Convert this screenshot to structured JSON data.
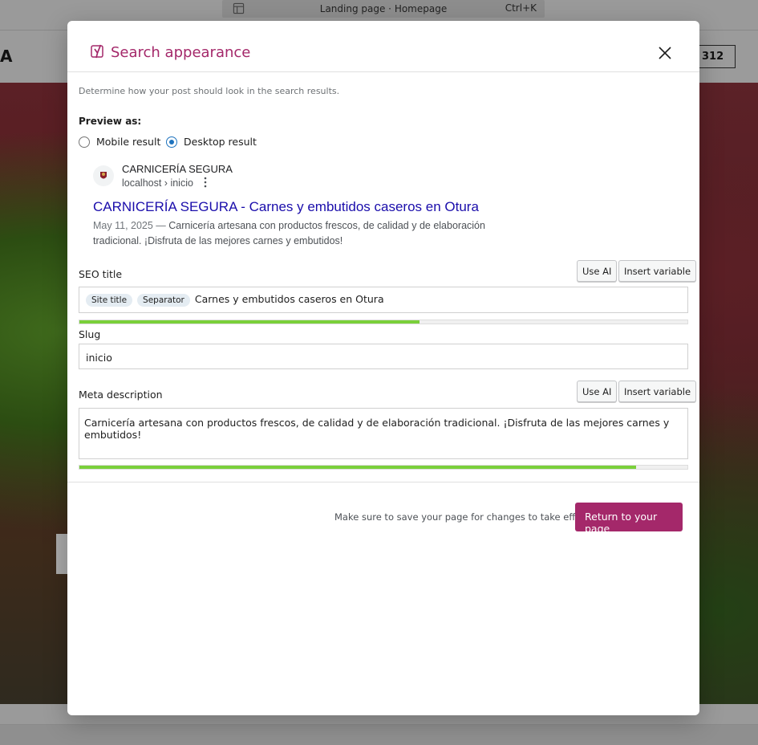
{
  "background": {
    "command_bar": {
      "label": "Landing page · Homepage",
      "shortcut": "Ctrl+K"
    },
    "logo_fragment": "A",
    "phone_button": "312"
  },
  "modal": {
    "title": "Search appearance",
    "intro": "Determine how your post should look in the search results.",
    "preview_label": "Preview as:",
    "preview_options": [
      {
        "label": "Mobile result",
        "checked": false
      },
      {
        "label": "Desktop result",
        "checked": true
      }
    ],
    "google_preview": {
      "site_name": "CARNICERÍA SEGURA",
      "url": "localhost › inicio",
      "title": "CARNICERÍA SEGURA - Carnes y embutidos caseros en Otura",
      "date": "May 11, 2025 —",
      "description": "Carnicería artesana con productos frescos, de calidad y de elaboración tradicional. ¡Disfruta de las mejores carnes y embutidos!"
    },
    "seo_title": {
      "label": "SEO title",
      "use_ai": "Use AI",
      "insert_variable": "Insert variable",
      "pills": [
        "Site title",
        "Separator"
      ],
      "value": "Carnes y embutidos caseros en Otura",
      "progress": 0.56
    },
    "slug": {
      "label": "Slug",
      "value": "inicio"
    },
    "meta_description": {
      "label": "Meta description",
      "use_ai": "Use AI",
      "insert_variable": "Insert variable",
      "value": "Carnicería artesana con productos frescos, de calidad y de elaboración tradicional. ¡Disfruta de las mejores carnes y embutidos!",
      "progress": 0.915
    },
    "footer": {
      "note": "Make sure to save your page for changes to take effect",
      "return_button": "Return to your page"
    }
  },
  "colors": {
    "brand": "#a4286a",
    "link": "#1a0dab",
    "progress_good": "#7ad03a",
    "radio_active": "#1e73be"
  }
}
